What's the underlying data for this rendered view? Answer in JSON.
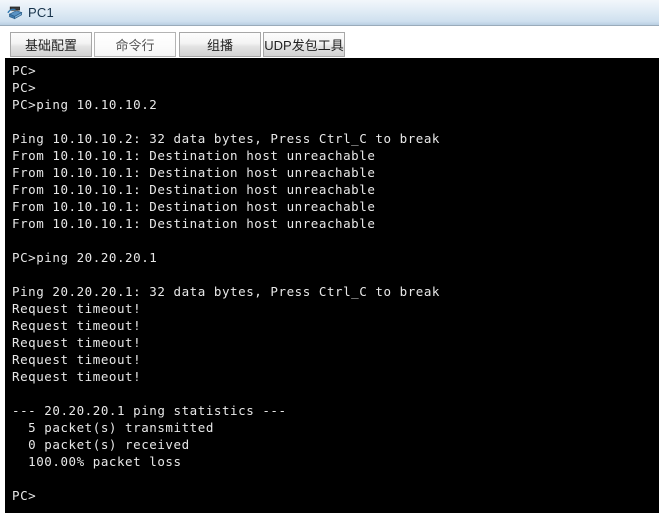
{
  "window": {
    "title": "PC1",
    "icon": "pc-host-icon"
  },
  "tabs": [
    {
      "label": "基础配置",
      "active": false,
      "name": "tab-basic-config"
    },
    {
      "label": "命令行",
      "active": true,
      "name": "tab-command-line"
    },
    {
      "label": "组播",
      "active": false,
      "name": "tab-multicast"
    },
    {
      "label": "UDP发包工具",
      "active": false,
      "name": "tab-udp-packet-tool"
    }
  ],
  "terminal": {
    "background_color": "#000000",
    "text_color": "#e8e8e8",
    "prompt": "PC>",
    "lines": [
      "PC>",
      "PC>",
      "PC>ping 10.10.10.2",
      "",
      "Ping 10.10.10.2: 32 data bytes, Press Ctrl_C to break",
      "From 10.10.10.1: Destination host unreachable",
      "From 10.10.10.1: Destination host unreachable",
      "From 10.10.10.1: Destination host unreachable",
      "From 10.10.10.1: Destination host unreachable",
      "From 10.10.10.1: Destination host unreachable",
      "",
      "PC>ping 20.20.20.1",
      "",
      "Ping 20.20.20.1: 32 data bytes, Press Ctrl_C to break",
      "Request timeout!",
      "Request timeout!",
      "Request timeout!",
      "Request timeout!",
      "Request timeout!",
      "",
      "--- 20.20.20.1 ping statistics ---",
      "  5 packet(s) transmitted",
      "  0 packet(s) received",
      "  100.00% packet loss",
      "",
      "PC>"
    ]
  }
}
